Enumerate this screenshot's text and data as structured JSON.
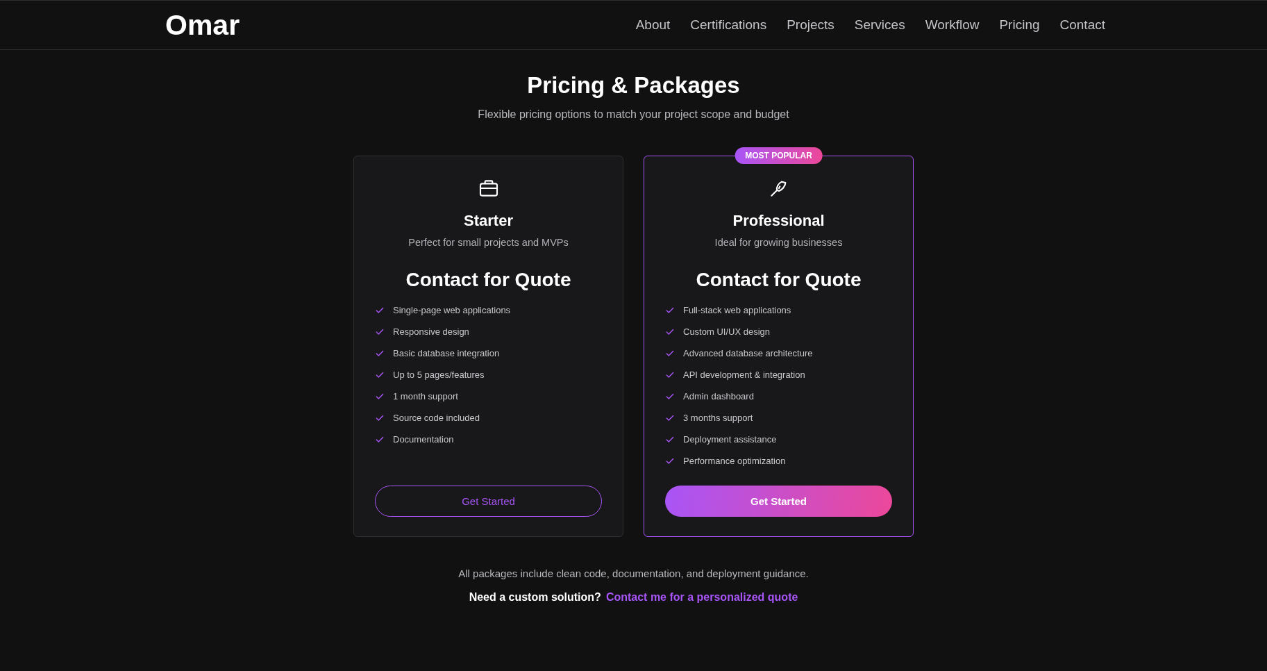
{
  "header": {
    "logo": "Omar",
    "nav": [
      {
        "label": "About"
      },
      {
        "label": "Certifications"
      },
      {
        "label": "Projects"
      },
      {
        "label": "Services"
      },
      {
        "label": "Workflow"
      },
      {
        "label": "Pricing"
      },
      {
        "label": "Contact"
      }
    ]
  },
  "section": {
    "title": "Pricing & Packages",
    "subtitle": "Flexible pricing options to match your project scope and budget"
  },
  "plans": [
    {
      "name": "Starter",
      "description": "Perfect for small projects and MVPs",
      "price": "Contact for Quote",
      "featured": false,
      "features": [
        "Single-page web applications",
        "Responsive design",
        "Basic database integration",
        "Up to 5 pages/features",
        "1 month support",
        "Source code included",
        "Documentation"
      ],
      "button": "Get Started"
    },
    {
      "badge": "MOST POPULAR",
      "name": "Professional",
      "description": "Ideal for growing businesses",
      "price": "Contact for Quote",
      "featured": true,
      "features": [
        "Full-stack web applications",
        "Custom UI/UX design",
        "Advanced database architecture",
        "API development & integration",
        "Admin dashboard",
        "3 months support",
        "Deployment assistance",
        "Performance optimization"
      ],
      "button": "Get Started"
    }
  ],
  "footer": {
    "note": "All packages include clean code, documentation, and deployment guidance.",
    "question": "Need a custom solution?",
    "link": "Contact me for a personalized quote"
  }
}
